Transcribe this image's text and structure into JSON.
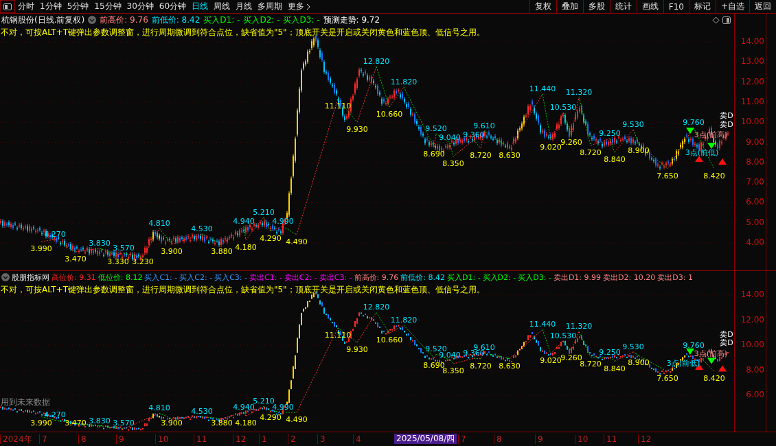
{
  "toolbar": {
    "periods": [
      {
        "label": "分时",
        "selected": false
      },
      {
        "label": "1分钟",
        "selected": false
      },
      {
        "label": "5分钟",
        "selected": false
      },
      {
        "label": "15分钟",
        "selected": false
      },
      {
        "label": "30分钟",
        "selected": false
      },
      {
        "label": "60分钟",
        "selected": false
      },
      {
        "label": "日线",
        "selected": true
      },
      {
        "label": "周线",
        "selected": false
      },
      {
        "label": "月线",
        "selected": false
      },
      {
        "label": "多周期",
        "selected": false
      }
    ],
    "more": "更多",
    "buttons": [
      "复权",
      "叠加",
      "多股",
      "统计",
      "画线",
      "F10",
      "标记",
      "+自选",
      "返回"
    ]
  },
  "main_panel": {
    "title": "杭钢股份(日线.前复权)",
    "legend": [
      {
        "text": "前高价: 9.76",
        "color": "#ff8080"
      },
      {
        "text": "前低价: 8.42",
        "color": "#00e5ff"
      },
      {
        "text": "买入D1: -",
        "color": "#00ff00"
      },
      {
        "text": "买入D2: -",
        "color": "#00ff00"
      },
      {
        "text": "买入D3: -",
        "color": "#00ff00"
      },
      {
        "text": "预测走势: 9.72",
        "color": "#ffffff"
      }
    ],
    "note": "不对，可按ALT+T键弹出参数调整窗，进行周期微调到符合点位，缺省值为\"5\"；顶底开关是开启或关闭黄色和蓝色顶、低信号之用。",
    "axis_ticks": [
      "14.00",
      "13.00",
      "12.00",
      "11.00",
      "10.00",
      "9.00",
      "8.00",
      "7.00",
      "6.00",
      "5.00",
      "4.00"
    ],
    "peak_labels": [
      {
        "text": "4.270",
        "kind": "high"
      },
      {
        "text": "3.990",
        "kind": "low"
      },
      {
        "text": "3.470",
        "kind": "low"
      },
      {
        "text": "3.830",
        "kind": "high"
      },
      {
        "text": "3.570",
        "kind": "high"
      },
      {
        "text": "3.330",
        "kind": "low"
      },
      {
        "text": "3.230",
        "kind": "low"
      },
      {
        "text": "4.810",
        "kind": "high"
      },
      {
        "text": "3.900",
        "kind": "low"
      },
      {
        "text": "4.530",
        "kind": "high"
      },
      {
        "text": "3.880",
        "kind": "low"
      },
      {
        "text": "4.940",
        "kind": "high"
      },
      {
        "text": "5.210",
        "kind": "high"
      },
      {
        "text": "4.180",
        "kind": "low"
      },
      {
        "text": "4.990",
        "kind": "high"
      },
      {
        "text": "4.290",
        "kind": "low"
      },
      {
        "text": "4.490",
        "kind": "low"
      },
      {
        "text": "11.110",
        "kind": "low"
      },
      {
        "text": "12.820",
        "kind": "high"
      },
      {
        "text": "9.930",
        "kind": "low"
      },
      {
        "text": "11.820",
        "kind": "high"
      },
      {
        "text": "10.660",
        "kind": "low"
      },
      {
        "text": "9.520",
        "kind": "high"
      },
      {
        "text": "9.040",
        "kind": "high"
      },
      {
        "text": "8.690",
        "kind": "low"
      },
      {
        "text": "9.610",
        "kind": "high"
      },
      {
        "text": "9.360",
        "kind": "high"
      },
      {
        "text": "8.350",
        "kind": "low"
      },
      {
        "text": "8.720",
        "kind": "low"
      },
      {
        "text": "8.630",
        "kind": "low"
      },
      {
        "text": "11.440",
        "kind": "high"
      },
      {
        "text": "11.320",
        "kind": "high"
      },
      {
        "text": "10.530",
        "kind": "high"
      },
      {
        "text": "9.020",
        "kind": "low"
      },
      {
        "text": "9.260",
        "kind": "low"
      },
      {
        "text": "9.530",
        "kind": "high"
      },
      {
        "text": "9.250",
        "kind": "high"
      },
      {
        "text": "8.720",
        "kind": "low"
      },
      {
        "text": "8.840",
        "kind": "low"
      },
      {
        "text": "8.900",
        "kind": "low"
      },
      {
        "text": "7.650",
        "kind": "low"
      },
      {
        "text": "9.760",
        "kind": "high"
      },
      {
        "text": "8.420",
        "kind": "low"
      }
    ],
    "signals": [
      {
        "text": "卖D",
        "kind": "sell"
      },
      {
        "text": "卖D",
        "kind": "sell"
      },
      {
        "text": "3点(前高)",
        "kind": "high"
      },
      {
        "text": "3点(前低)",
        "kind": "low"
      }
    ]
  },
  "indicator_panel": {
    "title": "股朋指标网",
    "legend": [
      {
        "text": "高位价: 9.31",
        "color": "#ff2020"
      },
      {
        "text": "低位价: 8.12",
        "color": "#00ff00"
      },
      {
        "text": "买入C1: -",
        "color": "#3399ff"
      },
      {
        "text": "买入C2: -",
        "color": "#3399ff"
      },
      {
        "text": "买入C3: -",
        "color": "#3399ff"
      },
      {
        "text": "卖出C1: -",
        "color": "#ff00ff"
      },
      {
        "text": "卖出C2: -",
        "color": "#ff00ff"
      },
      {
        "text": "卖出C3: -",
        "color": "#ff00ff"
      },
      {
        "text": "前高价: 9.76",
        "color": "#ff8080"
      },
      {
        "text": "前低价: 8.42",
        "color": "#00e5ff"
      },
      {
        "text": "买入D1: -",
        "color": "#00ff00"
      },
      {
        "text": "买入D2: -",
        "color": "#00ff00"
      },
      {
        "text": "买入D3: -",
        "color": "#00ff00"
      },
      {
        "text": "卖出D1: 9.99",
        "color": "#ff8080"
      },
      {
        "text": "卖出D2: 10.20",
        "color": "#ff8080"
      },
      {
        "text": "卖出D3: 1",
        "color": "#ff8080"
      }
    ],
    "note": "不对，可按ALT+T键弹出参数调整窗，进行周期微调到符合点位，缺省值为\"5\"；顶底开关是开启或关闭黄色和蓝色顶、低信号之用。",
    "axis_ticks": [
      "14.00",
      "12.00",
      "10.00",
      "8.00",
      "6.00"
    ],
    "peak_labels": [
      {
        "text": "4.270",
        "kind": "high"
      },
      {
        "text": "3.990",
        "kind": "low"
      },
      {
        "text": "3.470",
        "kind": "low"
      },
      {
        "text": "3.830",
        "kind": "high"
      },
      {
        "text": "3.570",
        "kind": "high"
      },
      {
        "text": "4.810",
        "kind": "high"
      },
      {
        "text": "3.900",
        "kind": "low"
      },
      {
        "text": "4.530",
        "kind": "high"
      },
      {
        "text": "3.880",
        "kind": "low"
      },
      {
        "text": "4.940",
        "kind": "high"
      },
      {
        "text": "5.210",
        "kind": "high"
      },
      {
        "text": "4.180",
        "kind": "low"
      },
      {
        "text": "4.990",
        "kind": "high"
      },
      {
        "text": "4.290",
        "kind": "low"
      },
      {
        "text": "4.490",
        "kind": "low"
      },
      {
        "text": "11.110",
        "kind": "low"
      },
      {
        "text": "12.820",
        "kind": "high"
      },
      {
        "text": "9.930",
        "kind": "low"
      },
      {
        "text": "11.820",
        "kind": "high"
      },
      {
        "text": "10.660",
        "kind": "low"
      },
      {
        "text": "9.520",
        "kind": "high"
      },
      {
        "text": "9.040",
        "kind": "high"
      },
      {
        "text": "8.690",
        "kind": "low"
      },
      {
        "text": "9.610",
        "kind": "high"
      },
      {
        "text": "9.360",
        "kind": "high"
      },
      {
        "text": "8.350",
        "kind": "low"
      },
      {
        "text": "8.720",
        "kind": "low"
      },
      {
        "text": "8.630",
        "kind": "low"
      },
      {
        "text": "11.440",
        "kind": "high"
      },
      {
        "text": "11.320",
        "kind": "high"
      },
      {
        "text": "10.530",
        "kind": "high"
      },
      {
        "text": "9.020",
        "kind": "low"
      },
      {
        "text": "9.260",
        "kind": "low"
      },
      {
        "text": "9.530",
        "kind": "high"
      },
      {
        "text": "9.250",
        "kind": "high"
      },
      {
        "text": "8.720",
        "kind": "low"
      },
      {
        "text": "8.840",
        "kind": "low"
      },
      {
        "text": "8.900",
        "kind": "low"
      },
      {
        "text": "7.650",
        "kind": "low"
      },
      {
        "text": "9.760",
        "kind": "high"
      },
      {
        "text": "8.420",
        "kind": "low"
      }
    ],
    "signals": [
      {
        "text": "卖D",
        "kind": "sell"
      },
      {
        "text": "卖D",
        "kind": "sell"
      },
      {
        "text": "3点(前高)",
        "kind": "high"
      },
      {
        "text": "3点(前低)",
        "kind": "low"
      }
    ],
    "footnote": "用到未来数据"
  },
  "time_axis": {
    "labels": [
      "2024年",
      "7",
      "8",
      "9",
      "10",
      "11",
      "12",
      "1",
      "2",
      "3",
      "4"
    ],
    "cursor_date": "2025/05/08/四",
    "labels_after": [
      "7",
      "8",
      "9",
      "10",
      "11",
      "12"
    ]
  }
}
